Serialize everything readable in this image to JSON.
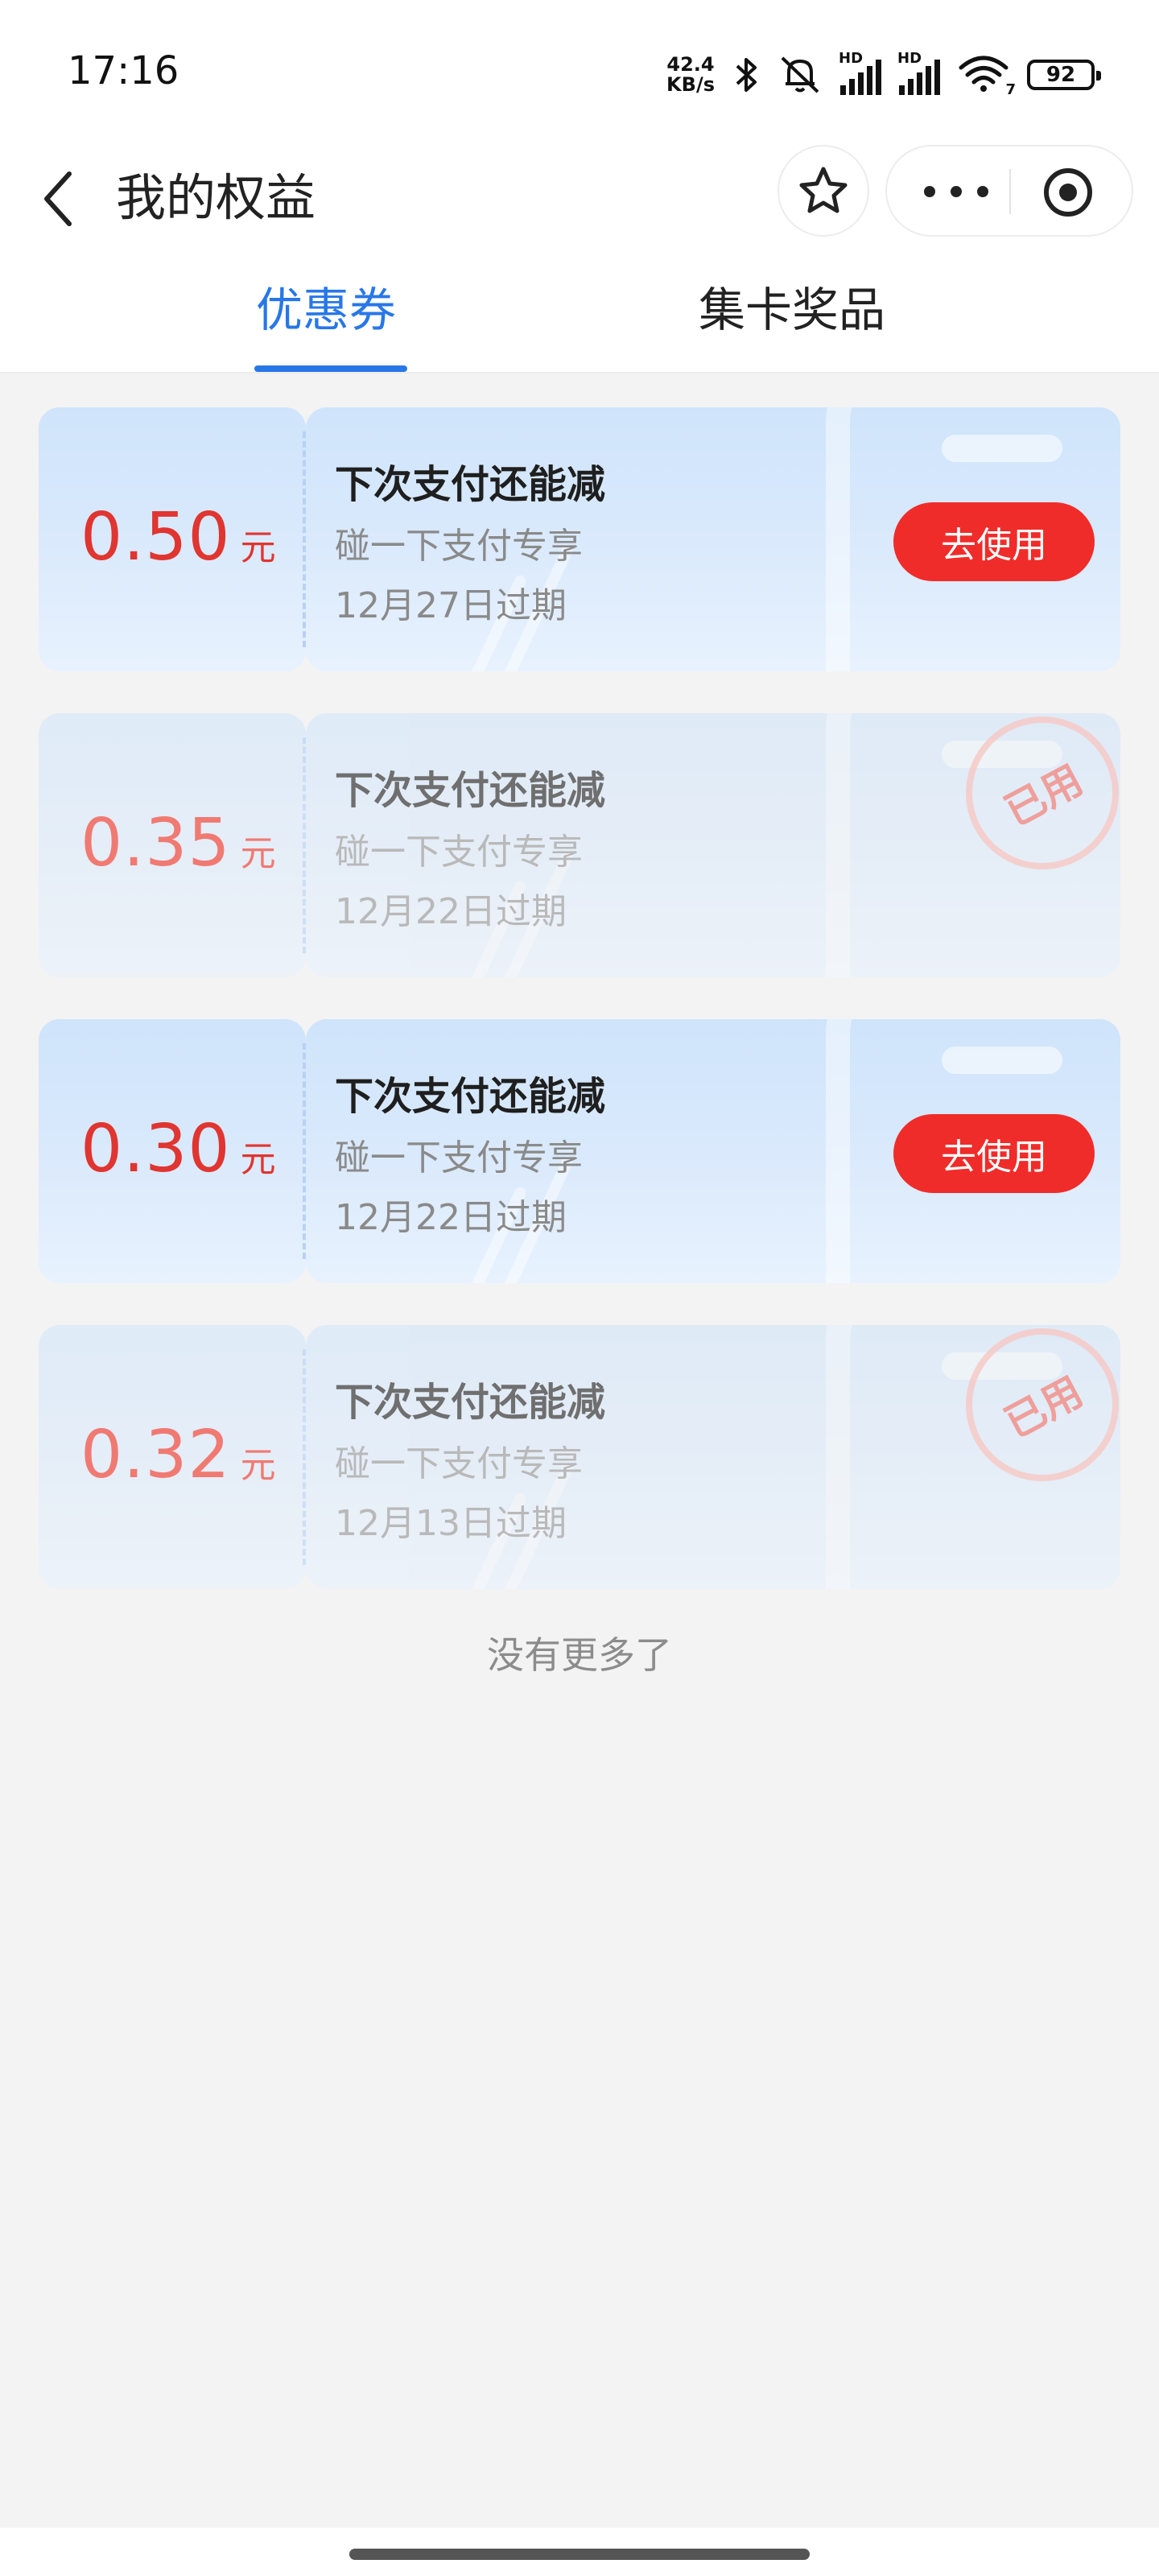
{
  "status_bar": {
    "time": "17:16",
    "net_speed_value": "42.4",
    "net_speed_unit": "KB/s",
    "sim1_label": "HD",
    "sim2_label": "HD",
    "wifi_label": "7",
    "battery": "92"
  },
  "header": {
    "title": "我的权益"
  },
  "tabs": [
    {
      "label": "优惠券",
      "active": true
    },
    {
      "label": "集卡奖品",
      "active": false
    }
  ],
  "coupons": [
    {
      "amount": "0.50",
      "unit": "元",
      "title": "下次支付还能减",
      "subtitle": "碰一下支付专享",
      "expiry": "12月27日过期",
      "status": "available",
      "action_label": "去使用"
    },
    {
      "amount": "0.35",
      "unit": "元",
      "title": "下次支付还能减",
      "subtitle": "碰一下支付专享",
      "expiry": "12月22日过期",
      "status": "used",
      "stamp_label": "已用"
    },
    {
      "amount": "0.30",
      "unit": "元",
      "title": "下次支付还能减",
      "subtitle": "碰一下支付专享",
      "expiry": "12月22日过期",
      "status": "available",
      "action_label": "去使用"
    },
    {
      "amount": "0.32",
      "unit": "元",
      "title": "下次支付还能减",
      "subtitle": "碰一下支付专享",
      "expiry": "12月13日过期",
      "status": "used",
      "stamp_label": "已用"
    }
  ],
  "footer": {
    "end_text": "没有更多了"
  },
  "colors": {
    "accent_blue": "#2877e8",
    "price_red": "#e03530",
    "button_red": "#f02c2a",
    "page_bg": "#f3f3f3"
  }
}
